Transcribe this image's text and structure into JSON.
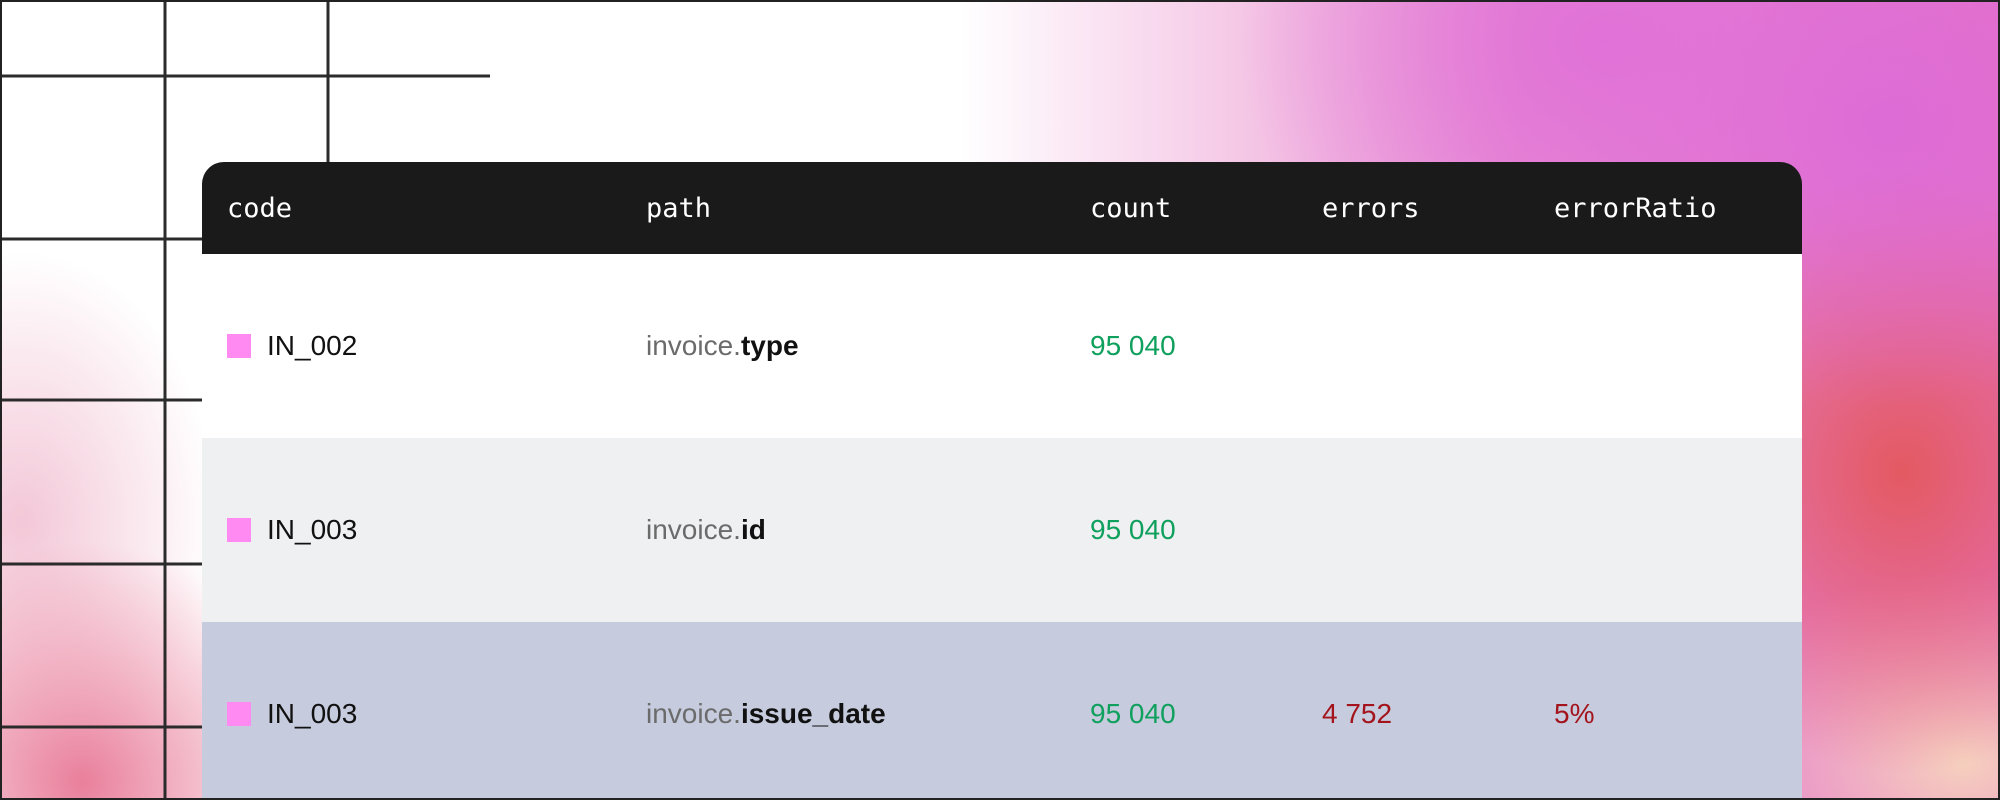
{
  "colors": {
    "header_bg": "#1a1a1a",
    "swatch": "#ff8af2",
    "count_text": "#10a05e",
    "error_text": "#a3141c",
    "row_bg": [
      "#ffffff",
      "#eff0f2",
      "#c6cbdd"
    ]
  },
  "table": {
    "columns": [
      "code",
      "path",
      "count",
      "errors",
      "errorRatio"
    ],
    "rows": [
      {
        "code": "IN_002",
        "path_prefix": "invoice.",
        "path_key": "type",
        "count": "95 040",
        "errors": "",
        "errorRatio": ""
      },
      {
        "code": "IN_003",
        "path_prefix": "invoice.",
        "path_key": "id",
        "count": "95 040",
        "errors": "",
        "errorRatio": ""
      },
      {
        "code": "IN_003",
        "path_prefix": "invoice.",
        "path_key": "issue_date",
        "count": "95 040",
        "errors": "4 752",
        "errorRatio": "5%"
      }
    ]
  }
}
